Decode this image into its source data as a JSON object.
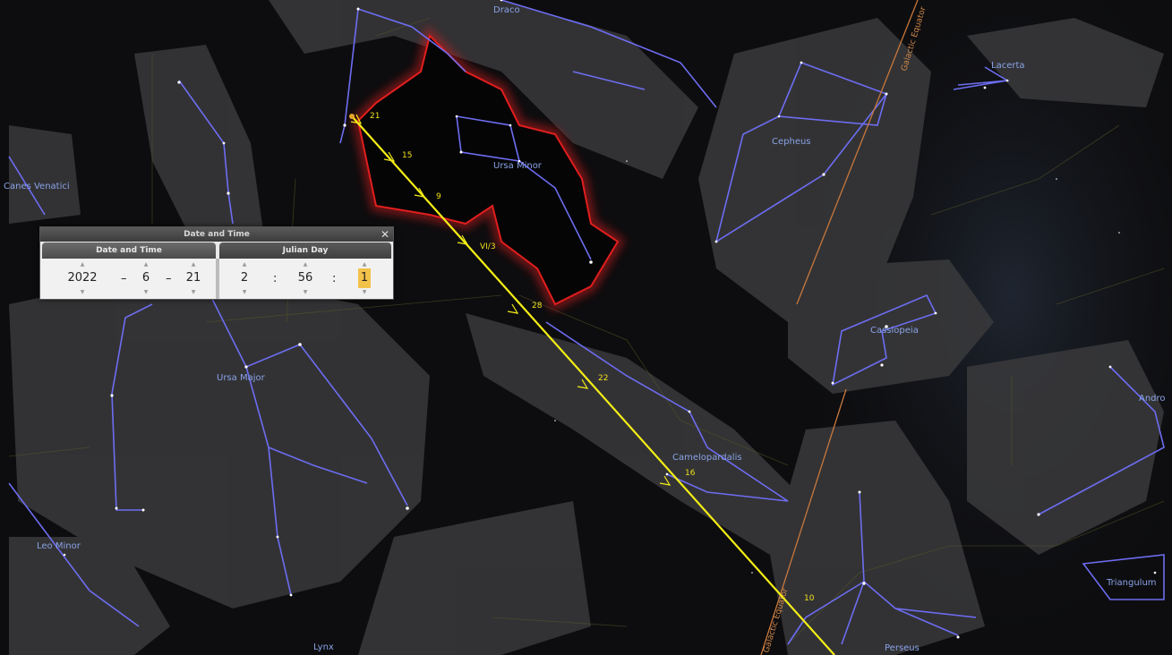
{
  "constellations": {
    "draco": "Draco",
    "lacerta": "Lacerta",
    "canes_venatici": "Canes Venatici",
    "cepheus": "Cepheus",
    "ursa_minor": "Ursa Minor",
    "ursa_major": "Ursa Major",
    "cassiopeia": "Cassiopeia",
    "camelopardalis": "Camelopardalis",
    "andromeda": "Andro",
    "leo_minor": "Leo Minor",
    "triangulum": "Triangulum",
    "lynx": "Lynx",
    "perseus": "Perseus"
  },
  "galactic_equator_label": "Galactic Equator",
  "meteor_marks": [
    "21",
    "15",
    "9",
    "VI/3",
    "28",
    "22",
    "16",
    "10"
  ],
  "dialog": {
    "title": "Date and Time",
    "tab_date_time": "Date and Time",
    "tab_julian_day": "Julian Day",
    "year": "2022",
    "month": "6",
    "day": "21",
    "hour": "2",
    "minute": "56",
    "second": "1",
    "date_sep": "–",
    "time_sep": ":",
    "close_glyph": "✕",
    "up_glyph": "▲",
    "down_glyph": "▼"
  },
  "colors": {
    "constellation_line": "#6d6df2",
    "meteor_track": "#f4ee16",
    "galactic_equator": "#c7783d",
    "boundary_highlight": "#d11a1a"
  }
}
